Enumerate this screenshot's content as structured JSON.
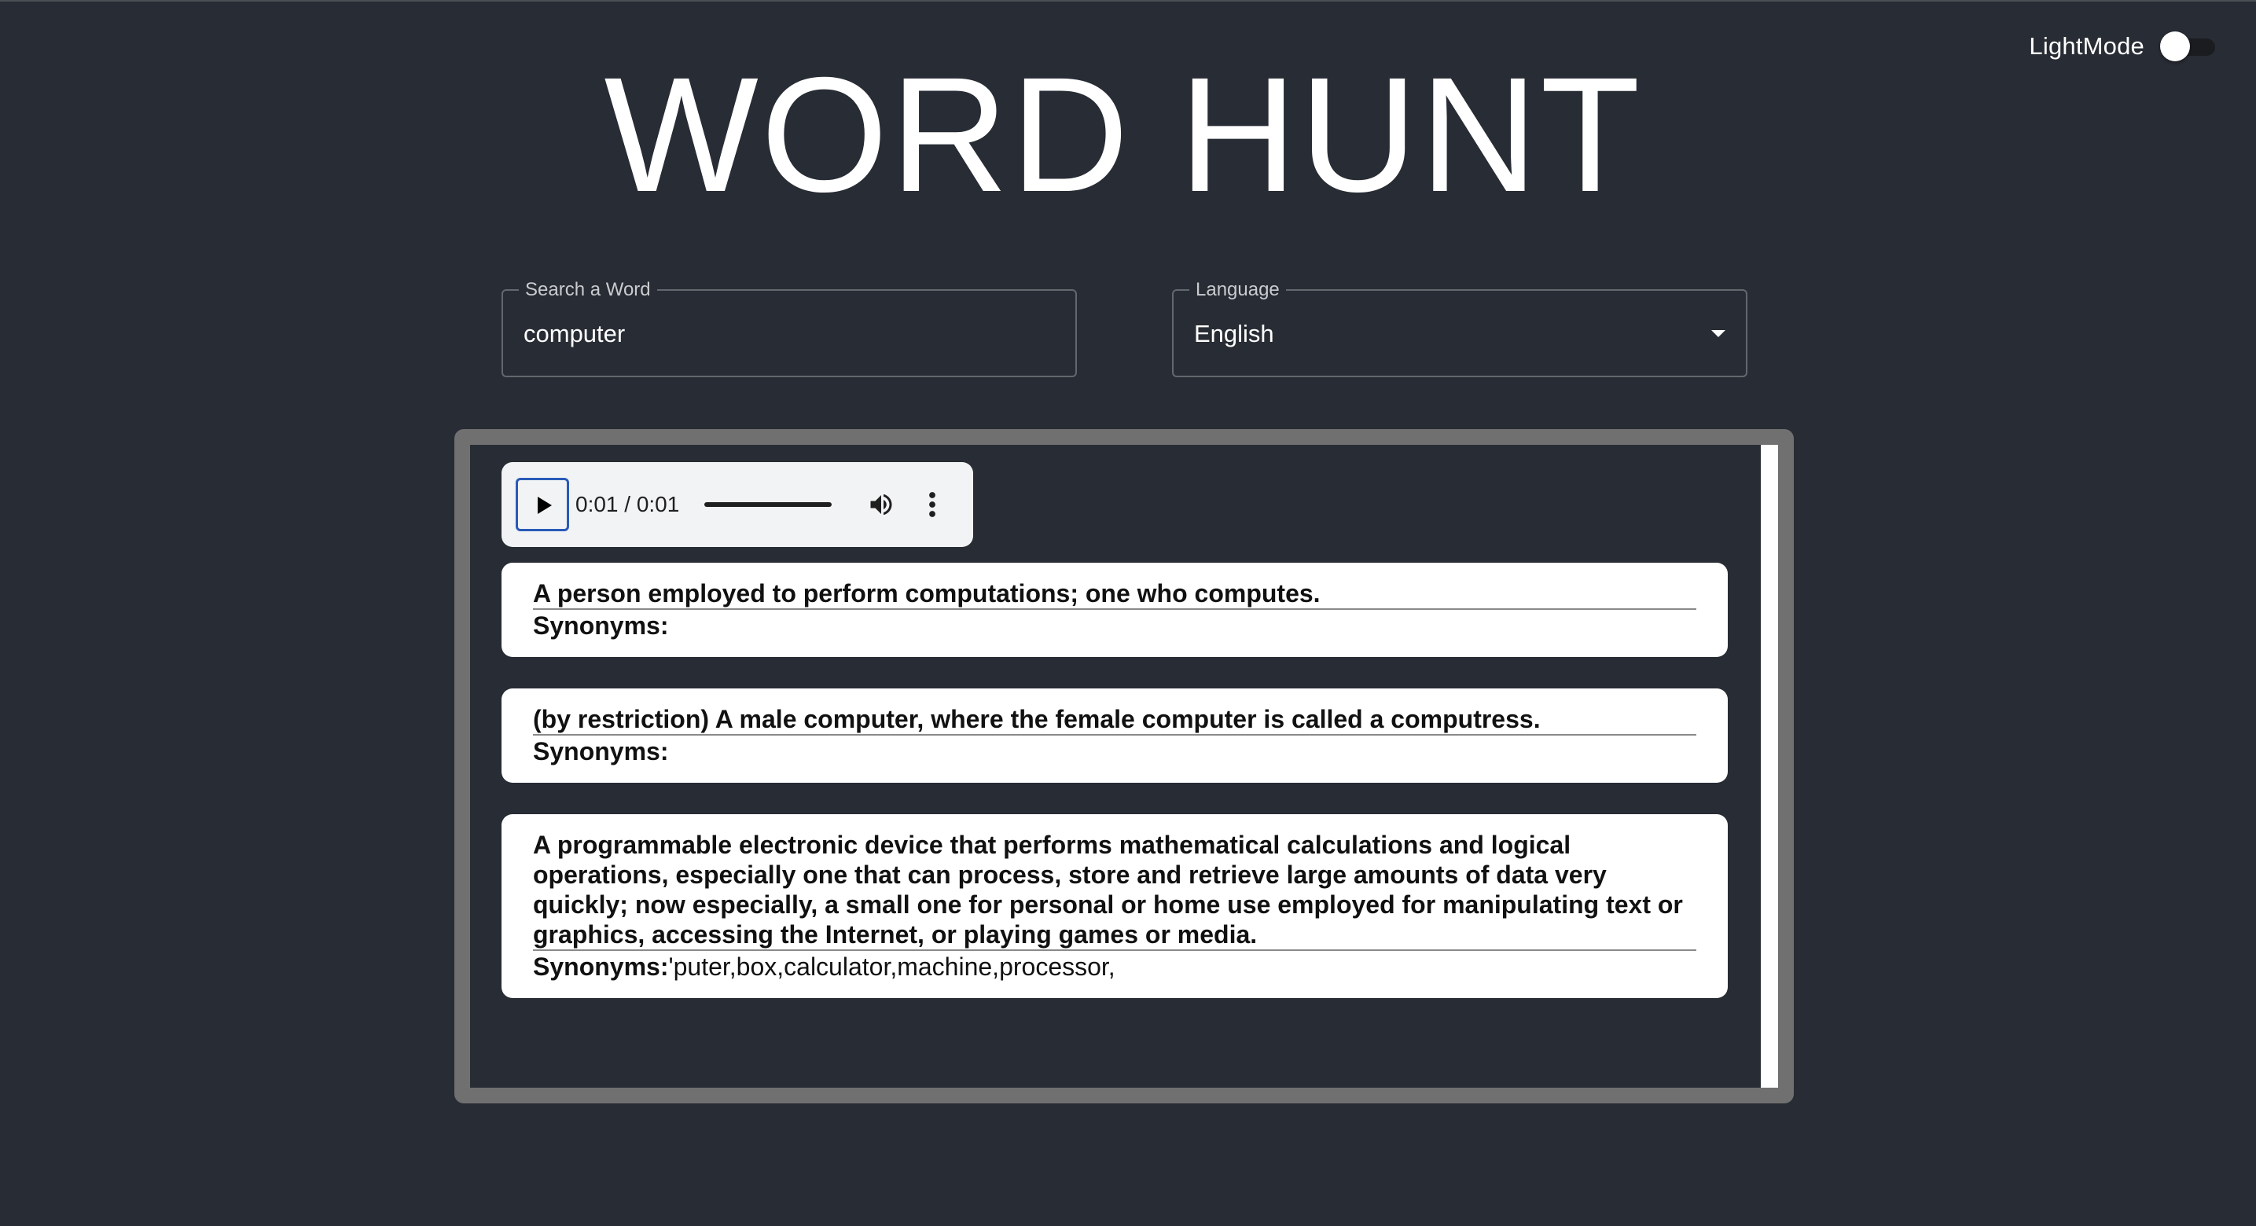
{
  "theme": {
    "background": "#282c34",
    "frame": "#707070",
    "accent": "#2a5ab8"
  },
  "header": {
    "mode_label": "LightMode",
    "title": "WORD HUNT"
  },
  "search": {
    "legend": "Search a Word",
    "value": "computer"
  },
  "language": {
    "legend": "Language",
    "selected": "English"
  },
  "audio": {
    "time": "0:01 / 0:01",
    "progress": 1.0,
    "icons": [
      "play-icon",
      "volume-icon",
      "more-options-icon"
    ]
  },
  "definitions": [
    {
      "text": "A person employed to perform computations; one who computes.",
      "synonyms_label": "Synonyms:",
      "synonyms": ""
    },
    {
      "text": "(by restriction) A male computer, where the female computer is called a computress.",
      "synonyms_label": "Synonyms:",
      "synonyms": ""
    },
    {
      "text": "A programmable electronic device that performs mathematical calculations and logical operations, especially one that can process, store and retrieve large amounts of data very quickly; now especially, a small one for personal or home use employed for manipulating text or graphics, accessing the Internet, or playing games or media.",
      "synonyms_label": "Synonyms:",
      "synonyms": "'puter,box,calculator,machine,processor,"
    }
  ]
}
